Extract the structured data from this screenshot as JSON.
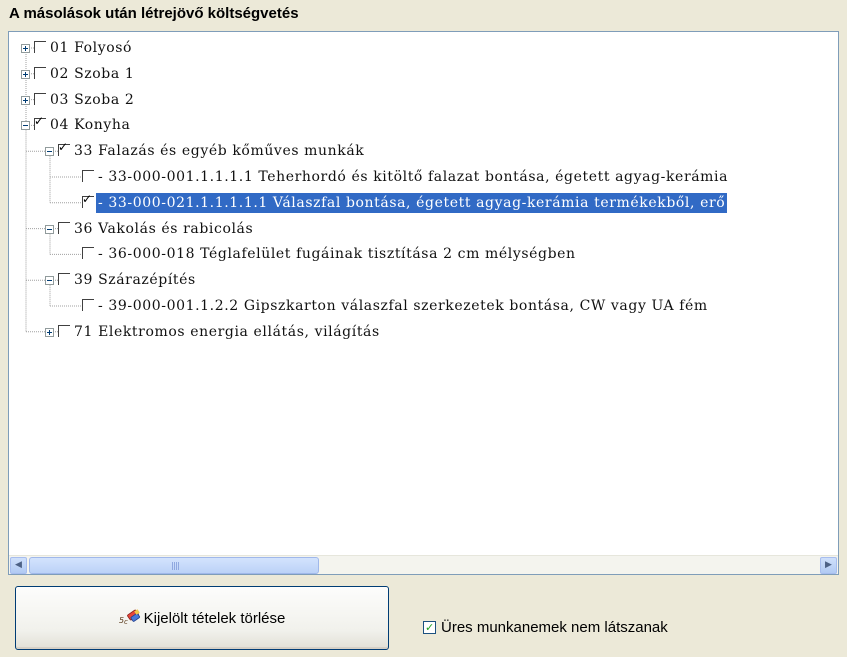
{
  "panel": {
    "title": "A másolások után létrejövő költségvetés"
  },
  "tree": [
    {
      "label": "01 Folyosó",
      "checked": false,
      "expandable": true,
      "expanded": false,
      "level": 0
    },
    {
      "label": "02 Szoba 1",
      "checked": false,
      "expandable": true,
      "expanded": false,
      "level": 0
    },
    {
      "label": "03 Szoba 2",
      "checked": false,
      "expandable": true,
      "expanded": false,
      "level": 0
    },
    {
      "label": "04 Konyha",
      "checked": true,
      "expandable": true,
      "expanded": true,
      "level": 0
    },
    {
      "label": "33 Falazás és egyéb kőműves munkák",
      "checked": true,
      "expandable": true,
      "expanded": true,
      "level": 1
    },
    {
      "label": " - 33-000-001.1.1.1.1 Teherhordó és kitöltő falazat bontása, égetett agyag-kerámia",
      "checked": false,
      "expandable": false,
      "level": 2
    },
    {
      "label": " - 33-000-021.1.1.1.1.1 Válaszfal bontása, égetett agyag-kerámia termékekből, erő",
      "checked": true,
      "expandable": false,
      "level": 2,
      "selected": true
    },
    {
      "label": "36 Vakolás és rabicolás",
      "checked": false,
      "expandable": true,
      "expanded": true,
      "level": 1
    },
    {
      "label": " - 36-000-018 Téglafelület fugáinak tisztítása 2 cm mélységben",
      "checked": false,
      "expandable": false,
      "level": 2
    },
    {
      "label": "39 Szárazépítés",
      "checked": false,
      "expandable": true,
      "expanded": true,
      "level": 1
    },
    {
      "label": " - 39-000-001.1.2.2 Gipszkarton válaszfal szerkezetek bontása, CW vagy UA fém",
      "checked": false,
      "expandable": false,
      "level": 2
    },
    {
      "label": "71 Elektromos energia ellátás, világítás",
      "checked": false,
      "expandable": true,
      "expanded": false,
      "level": 1
    }
  ],
  "buttons": {
    "delete_label": "Kijelölt tételek törlése",
    "delete_icon": "eraser-icon"
  },
  "options": {
    "hide_empty_label": "Üres munkanemek nem látszanak",
    "hide_empty_checked": true
  },
  "colors": {
    "selection": "#316ac5",
    "background": "#ece9d8",
    "tree_border": "#7f9db9"
  }
}
